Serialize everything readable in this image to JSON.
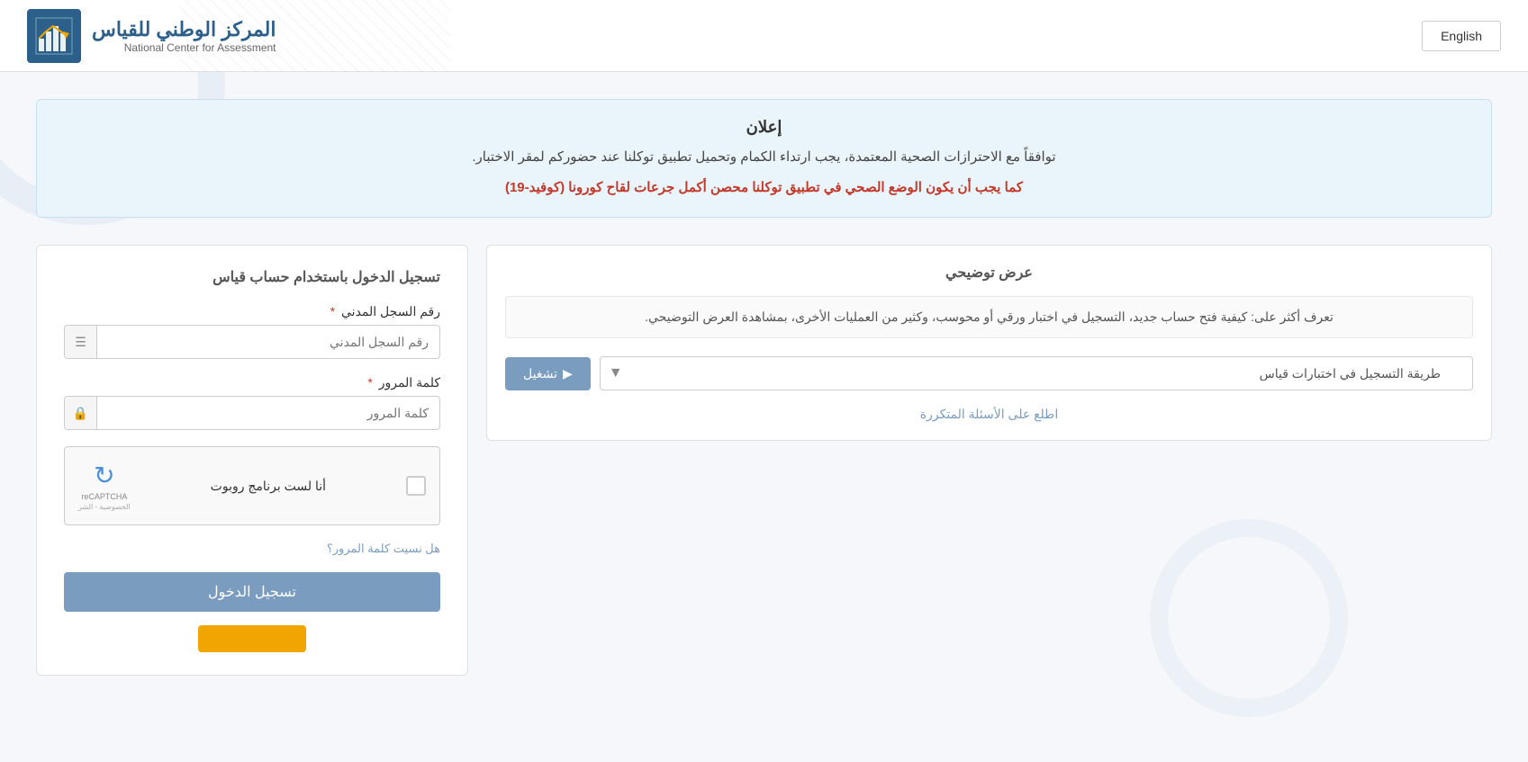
{
  "header": {
    "english_btn": "English",
    "logo_arabic": "المركز الوطني للقياس",
    "logo_english": "National Center for Assessment"
  },
  "announcement": {
    "title": "إعلان",
    "text": "توافقاً مع الاحترازات الصحية المعتمدة، يجب ارتداء الكمام وتحميل تطبيق توكلنا عند حضوركم لمقر الاختبار.",
    "warning": "كما يجب أن يكون الوضع الصحي في تطبيق توكلنا محصن أكمل جرعات لقاح كورونا (كوفيد-19)"
  },
  "demo_panel": {
    "title": "عرض توضيحي",
    "description": "تعرف أكثر على: كيفية فتح حساب جديد، التسجيل في اختبار ورقي أو محوسب، وكثير من العمليات الأخرى، بمشاهدة العرض التوضيحي.",
    "select_placeholder": "طريقة التسجيل في اختبارات قياس",
    "run_btn": "تشغيل",
    "faq_link": "اطلع على الأسئلة المتكررة"
  },
  "login_panel": {
    "title": "تسجيل الدخول باستخدام حساب قياس",
    "id_label": "رقم السجل المدني",
    "id_required": "*",
    "id_placeholder": "رقم السجل المدني",
    "password_label": "كلمة المرور",
    "password_required": "*",
    "password_placeholder": "كلمة المرور",
    "captcha_label": "أنا لست برنامج روبوت",
    "captcha_logo": "reCAPTCHA",
    "captcha_sub1": "الخصوصية - الشر",
    "forgot_link": "هل نسيت كلمة المرور؟",
    "login_btn": "تسجيل الدخول"
  }
}
